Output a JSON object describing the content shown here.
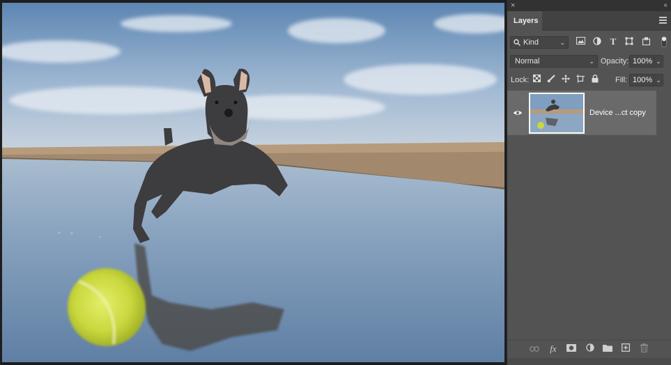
{
  "panel": {
    "close_glyph": "×",
    "collapse_glyph": "‹‹",
    "tab_label": "Layers",
    "filter": {
      "kind_label": "Kind",
      "icons": [
        "image-filter-icon",
        "adjustment-filter-icon",
        "type-filter-icon",
        "shape-filter-icon",
        "smart-object-filter-icon"
      ]
    },
    "blend_mode": "Normal",
    "opacity_label": "Opacity:",
    "opacity_value": "100%",
    "lock_label": "Lock:",
    "fill_label": "Fill:",
    "fill_value": "100%",
    "layers": [
      {
        "name": "Device ...ct copy",
        "visible": true,
        "selected": true
      }
    ],
    "footer_icons": [
      "link-layers-icon",
      "fx-icon",
      "add-mask-icon",
      "adjustment-layer-icon",
      "group-folder-icon",
      "new-layer-icon",
      "trash-icon"
    ],
    "fx_label": "fx"
  },
  "colors": {
    "panel_bg": "#535353",
    "selected_layer": "#6a6a6a",
    "app_bg": "#1e1e1e"
  }
}
